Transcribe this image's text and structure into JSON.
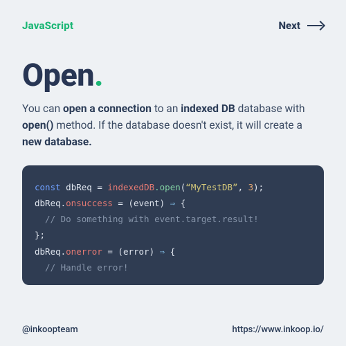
{
  "topbar": {
    "brand": "JavaScript",
    "next_label": "Next"
  },
  "title": {
    "word": "Open",
    "dot": "."
  },
  "desc": {
    "t1": "You can ",
    "b1": "open a connection",
    "t2": " to an ",
    "b2": "indexed DB",
    "t3": " database with ",
    "b3": "open()",
    "t4": " method. If the database doesn't exist, it will create a ",
    "b4": "new database."
  },
  "code": {
    "kw_const": "const",
    "var_dbReq": " dbReq ",
    "eq": "= ",
    "obj_indexedDB": "indexedDB",
    "call_open": ".open",
    "lp": "(",
    "str_db": "“MyTestDB”",
    "comma": ", ",
    "num_ver": "3",
    "rp_semi": ");",
    "line2_a": "dbReq.",
    "prop_onsuccess": "onsuccess",
    "line2_b": " = (event) ",
    "arrow": "⇒",
    "line2_c": " {",
    "comment1": "  // Do something with event.target.result!",
    "line4": "};",
    "line5_a": "dbReq.",
    "prop_onerror": "onerror",
    "line5_b": " = (error) ",
    "line5_c": " {",
    "comment2": "  // Handle error!"
  },
  "footer": {
    "handle": "@inkoopteam",
    "url": "https://www.inkoop.io/"
  }
}
